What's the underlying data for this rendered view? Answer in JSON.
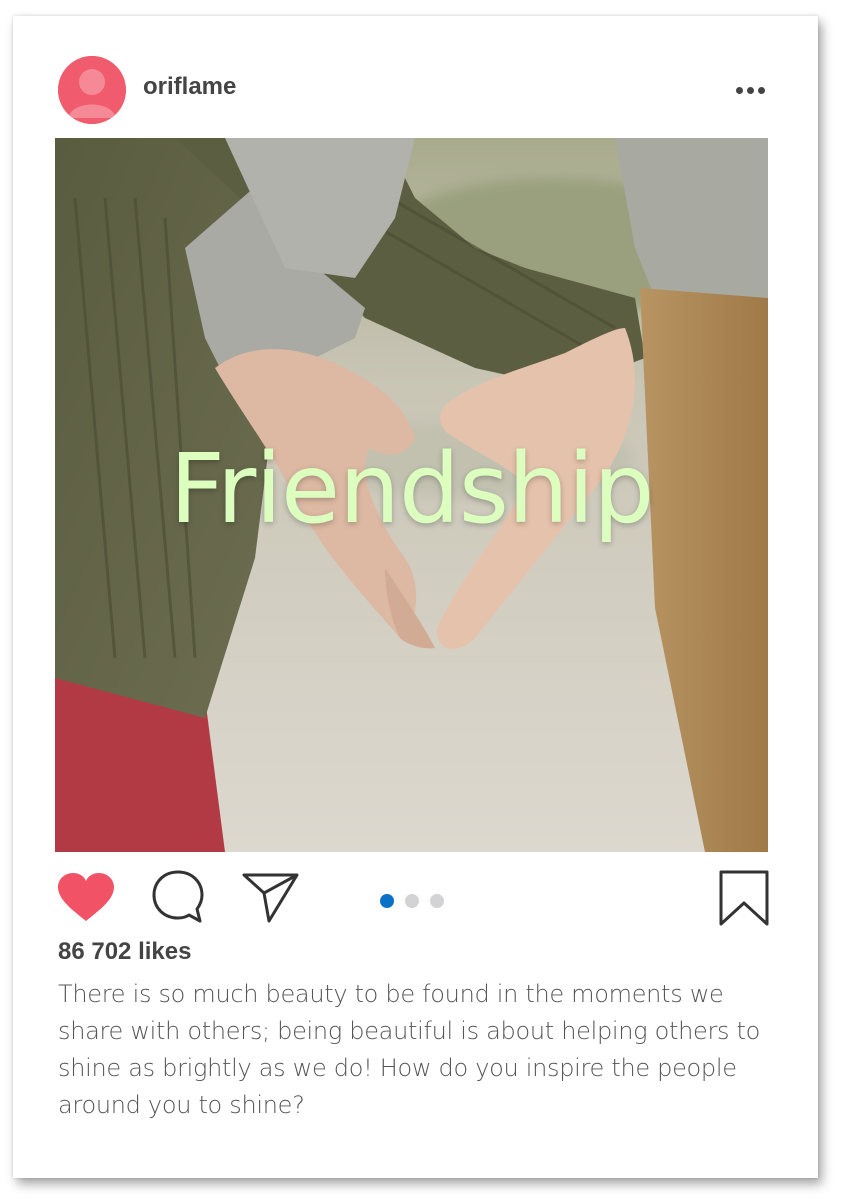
{
  "post": {
    "username": "oriflame",
    "image_title": "Friendship",
    "likes": "86 702 likes",
    "caption": "There is so much beauty to be found in the moments we share with others; being beautiful is about helping others to shine as brightly as we do! How do you inspire the people around you to shine?",
    "carousel": {
      "total": 3,
      "active_index": 0
    },
    "liked": true
  },
  "colors": {
    "avatar": "#f05c6d",
    "heart": "#f15266",
    "active_dot": "#0a72c6",
    "title_text": "#dcffc0"
  },
  "icons": [
    "user-avatar-icon",
    "more-options-icon",
    "heart-icon",
    "comment-icon",
    "send-icon",
    "bookmark-icon"
  ]
}
